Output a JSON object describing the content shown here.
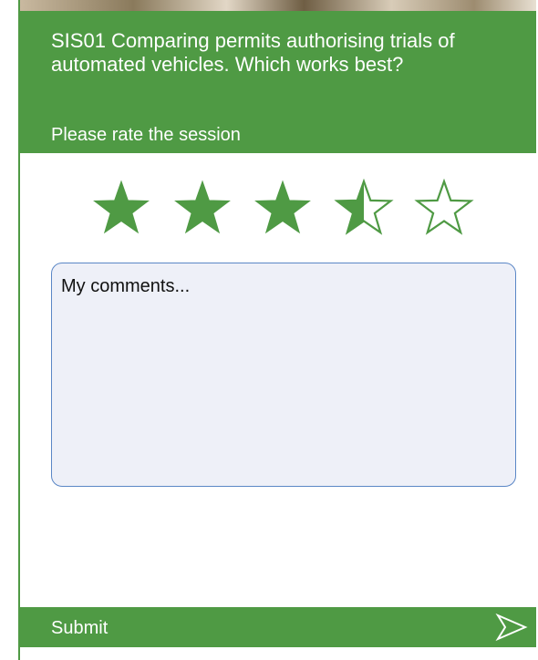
{
  "session": {
    "title": "SIS01 Comparing permits authorising trials of automated vehicles.  Which works best?",
    "rate_prompt": "Please rate the session"
  },
  "rating": {
    "value": 3.5,
    "max": 5
  },
  "comments": {
    "placeholder": "My comments...",
    "value": ""
  },
  "footer": {
    "submit_label": "Submit",
    "submit_icon": "send-icon"
  },
  "colors": {
    "brand_green": "#4f9a44",
    "comment_bg": "#eef0f8",
    "comment_border": "#5a86c6"
  }
}
